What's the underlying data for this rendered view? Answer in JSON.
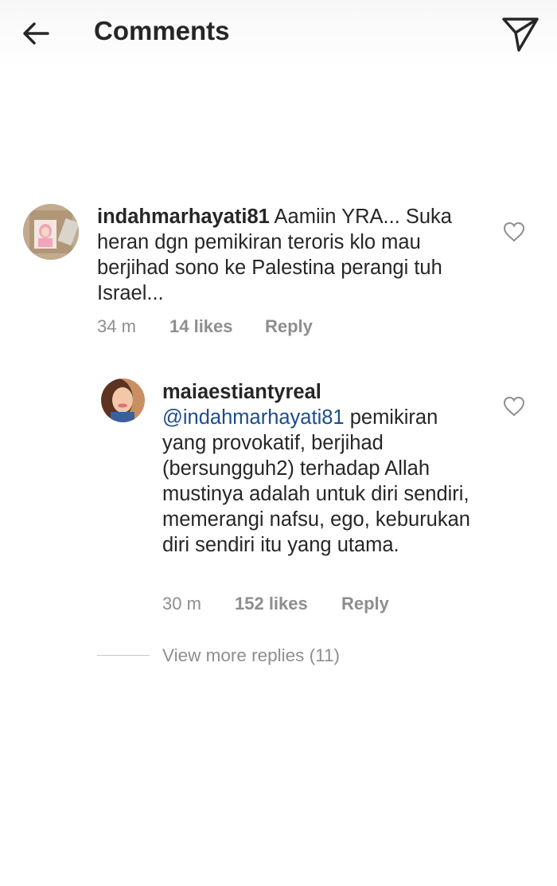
{
  "header": {
    "title": "Comments",
    "back_icon": "back-arrow-icon",
    "send_icon": "send-direct-icon"
  },
  "comments": [
    {
      "username": "indahmarhayati81",
      "text": "Aamiin YRA... Suka heran dgn pemikiran teroris klo mau berjihad sono ke Palestina perangi tuh Israel...",
      "time": "34 m",
      "likes": "14 likes",
      "reply": "Reply"
    },
    {
      "username": "maiaestiantyreal",
      "mention": "@indahmarhayati81",
      "text": "pemikiran yang provokatif, berjihad (bersungguh2) terhadap Allah mustinya adalah untuk diri sendiri, memerangi nafsu, ego, keburukan diri sendiri itu yang utama.",
      "time": "30 m",
      "likes": "152 likes",
      "reply": "Reply"
    }
  ],
  "view_more_replies": "View more replies (11)",
  "colors": {
    "mention": "#1d4d8a",
    "secondary_text": "#8e8e8e",
    "primary_text": "#262626"
  }
}
